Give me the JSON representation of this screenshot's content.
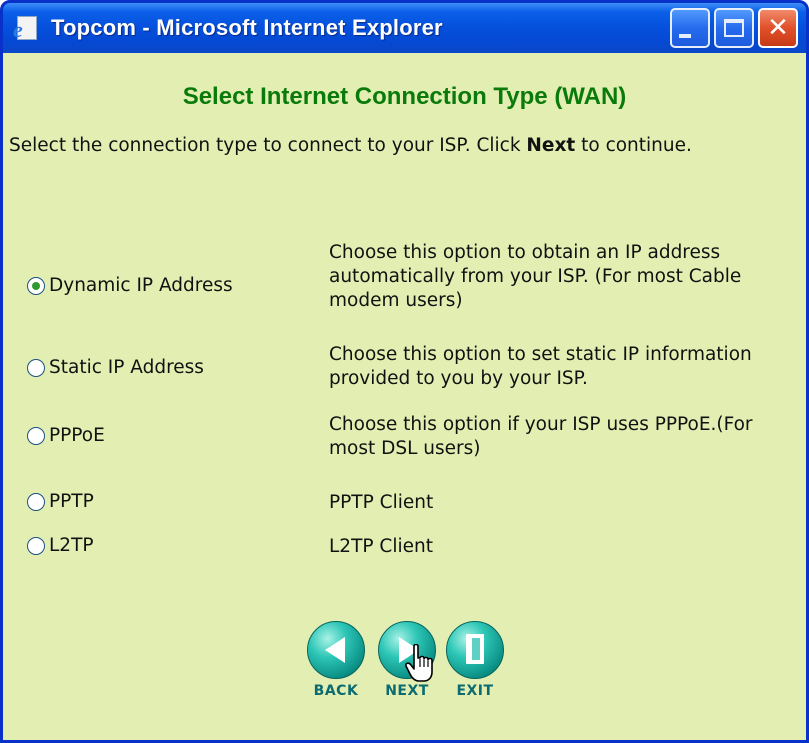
{
  "window": {
    "title": "Topcom - Microsoft Internet Explorer"
  },
  "page": {
    "heading": "Select Internet Connection Type (WAN)",
    "intro_before": "Select the connection type to connect to your ISP. Click ",
    "intro_bold": "Next",
    "intro_after": " to continue."
  },
  "options": [
    {
      "label": "Dynamic IP Address",
      "selected": true,
      "desc": "Choose this option to obtain an IP address automatically from your ISP. (For most Cable modem users)"
    },
    {
      "label": "Static IP Address",
      "selected": false,
      "desc": "Choose this option to set static IP information provided to you by your ISP."
    },
    {
      "label": "PPPoE",
      "selected": false,
      "desc": "Choose this option if your ISP uses PPPoE.(For most DSL users)"
    },
    {
      "label": "PPTP",
      "selected": false,
      "desc": "PPTP Client"
    },
    {
      "label": "L2TP",
      "selected": false,
      "desc": "L2TP Client"
    }
  ],
  "nav": {
    "back_label": "BACK",
    "next_label": "NEXT",
    "exit_label": "EXIT"
  },
  "icons": {
    "window": "ie-page-icon",
    "minimize": "minimize-icon",
    "maximize": "maximize-icon",
    "close": "close-icon",
    "back": "arrow-left-icon",
    "next": "arrow-right-icon",
    "exit": "door-exit-icon",
    "cursor": "hand-pointer-icon"
  },
  "colors": {
    "content_background": "#e3eeb2",
    "heading": "#0a7a0a",
    "nav_button": "#2dc6b6",
    "nav_label": "#0b6b70",
    "titlebar": "#0550dc"
  }
}
